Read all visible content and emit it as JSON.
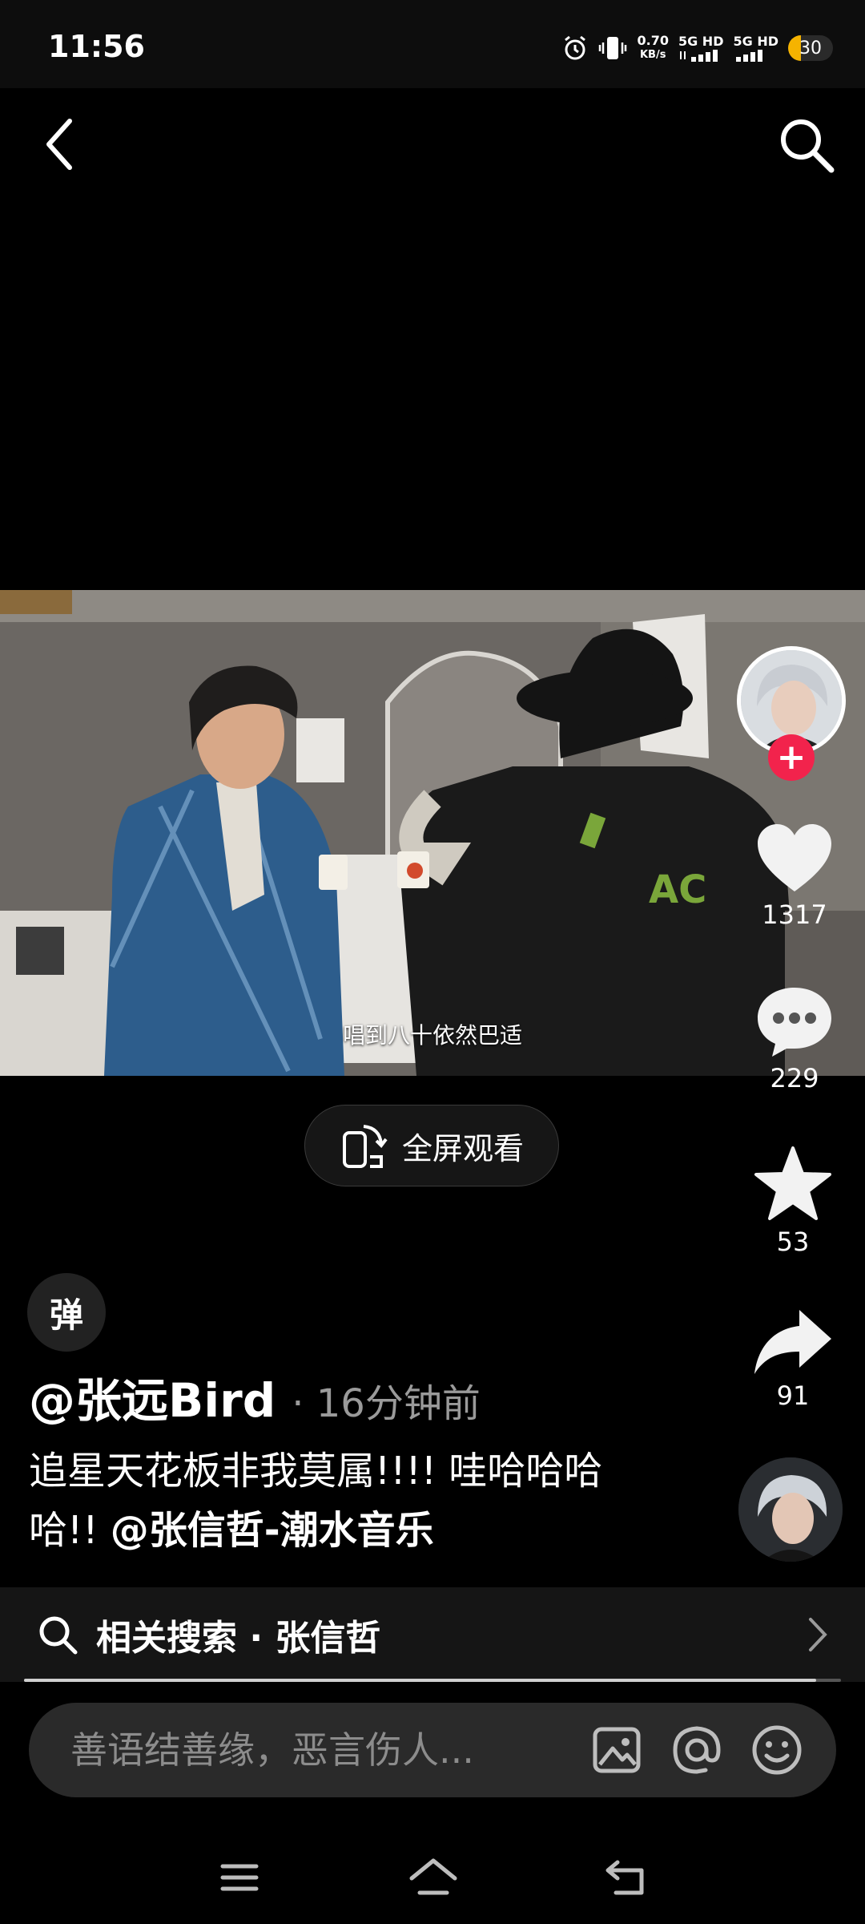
{
  "status_bar": {
    "time": "11:56",
    "net_speed_value": "0.70",
    "net_speed_unit": "KB/s",
    "sim1_label": "5G HD",
    "sim2_label": "5G HD",
    "battery_level": "30"
  },
  "video": {
    "subtitle": "唱到八十依然巴适",
    "fullscreen_label": "全屏观看"
  },
  "actions": {
    "like_count": "1317",
    "comment_count": "229",
    "favorite_count": "53",
    "share_count": "91"
  },
  "post": {
    "danmu_label": "弹",
    "author": "@张远Bird",
    "time": "· 16分钟前",
    "description": "追星天花板非我莫属!!!!  哇哈哈哈哈!!  ",
    "mention": "@张信哲-潮水音乐"
  },
  "related_search": {
    "label": "相关搜索 · 张信哲"
  },
  "playback": {
    "progress": 0.97
  },
  "comment": {
    "placeholder": "善语结善缘，恶言伤人..."
  },
  "colors": {
    "follow_badge": "#f2234c",
    "battery": "#f5b300",
    "background": "#000000"
  }
}
